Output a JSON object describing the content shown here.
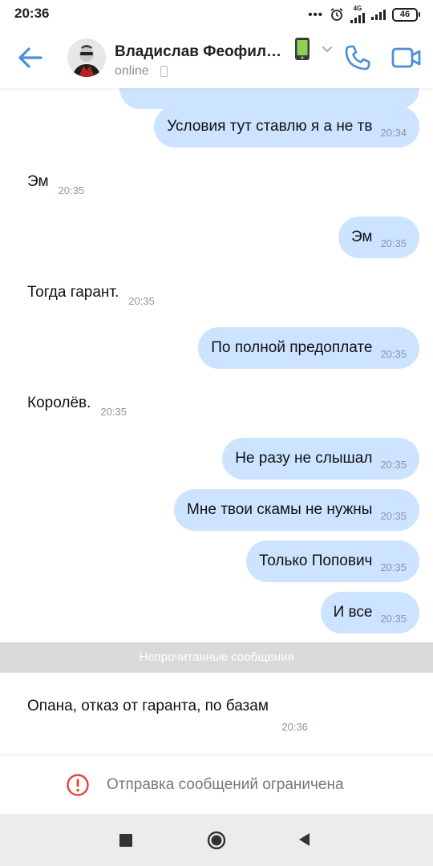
{
  "status_bar": {
    "time": "20:36",
    "dots": "•••",
    "network": "4G",
    "battery": "46"
  },
  "header": {
    "contact_name": "Владислав Феофил…",
    "status": "online",
    "name_emoji": "mobile-phone",
    "icons": {
      "back": "back-arrow-icon",
      "call": "phone-icon",
      "video": "video-camera-icon"
    },
    "accent_color": "#4a8fd6"
  },
  "messages": [
    {
      "dir": "out",
      "text": "Условия тут ставлю я а не тв",
      "time": "20:34"
    },
    {
      "dir": "in",
      "text": "Эм",
      "time": "20:35"
    },
    {
      "dir": "out",
      "text": "Эм",
      "time": "20:35"
    },
    {
      "dir": "in",
      "text": "Тогда гарант.",
      "time": "20:35"
    },
    {
      "dir": "out",
      "text": "По полной предоплате",
      "time": "20:35"
    },
    {
      "dir": "in",
      "text": "Королёв.",
      "time": "20:35"
    },
    {
      "dir": "out",
      "text": "Не разу не слышал",
      "time": "20:35"
    },
    {
      "dir": "out",
      "text": "Мне твои скамы не нужны",
      "time": "20:35"
    },
    {
      "dir": "out",
      "text": "Только Попович",
      "time": "20:35"
    },
    {
      "dir": "out",
      "text": "И все",
      "time": "20:35"
    }
  ],
  "unread_divider": "Непрочитанные сообщения",
  "last_message": {
    "text": "Опана, отказ от гаранта, по базам",
    "time": "20:36"
  },
  "restriction": {
    "text": "Отправка сообщений ограничена",
    "icon": "warning-icon",
    "icon_color": "#e0463c"
  },
  "colors": {
    "bubble_out": "#cce4ff",
    "divider": "#d8d9da"
  }
}
